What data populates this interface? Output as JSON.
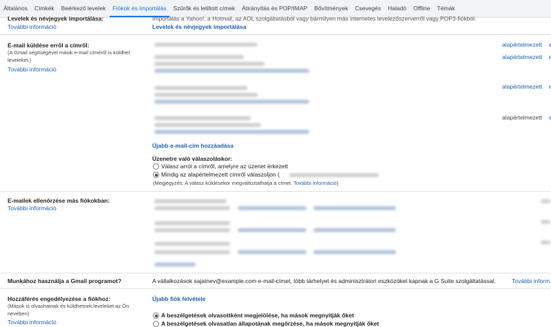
{
  "tabs": [
    {
      "label": "Általános",
      "active": false
    },
    {
      "label": "Címkék",
      "active": false
    },
    {
      "label": "Beérkező levelek",
      "active": false
    },
    {
      "label": "Fiókok és importálás",
      "active": true
    },
    {
      "label": "Szűrők és letiltott címek",
      "active": false
    },
    {
      "label": "Átirányítás és POP/IMAP",
      "active": false
    },
    {
      "label": "Bővítmények",
      "active": false
    },
    {
      "label": "Csevegés",
      "active": false
    },
    {
      "label": "Haladó",
      "active": false
    },
    {
      "label": "Offline",
      "active": false
    },
    {
      "label": "Témák",
      "active": false
    }
  ],
  "import": {
    "label": "Levelek és névjegyek importálása:",
    "more": "További információ",
    "desc": "Importálás a Yahoo!, a Hotmail, az AOL szolgáltatásból vagy bármilyen más internetes levelezőszerverről vagy POP3-fiókból.",
    "action": "Levelek és névjegyek importálása"
  },
  "send_as": {
    "label": "E-mail küldése erről a címről:",
    "note": "(A Gmail segítségével másik e-mail címéről is küldhet leveleket.)",
    "more": "További információ",
    "default_labels": [
      "alapértelmezett",
      "alapértelmezett",
      "alapértelmezett",
      "alapértelmezett"
    ],
    "add_link": "Újabb e-mail-cím hozzáadása",
    "reply_heading": "Üzenetre való válaszoláskor:",
    "reply_opt1": "Válasz arról a címről, amelyre az üzenet érkezett",
    "reply_opt2": "Mindig az alapértelmezett címről válaszoljon (",
    "reply_note": "(Megjegyzés: A válasz küldésekor megváltoztathatja a címet.",
    "reply_note_link": "További információ",
    "reply_note_end": ")"
  },
  "check_mail": {
    "label": "E-mailek ellenőrzése más fiókokban:",
    "more": "További információ"
  },
  "gsuite": {
    "label": "Munkához használja a Gmail programot?",
    "text": "A vállalkozások sajatnev@example.com e-mail-címet, több tárhelyet és adminisztrátori eszközöket kapnak a G Suite szolgáltatással.",
    "more": "További inform"
  },
  "grant": {
    "label": "Hozzáférés engedélyezése a fiókhoz:",
    "note": "(Mások is olvashatnak és küldhetnek leveleket az Ön nevében)",
    "more": "További információ",
    "add_link": "Újabb fiók felvétele",
    "opt1": "A beszélgetések olvasottként megjelölése, ha mások megnyitják őket",
    "opt2": "A beszélgetések olvasatlan állapotának megőrzése, ha mások megnyitják őket"
  }
}
